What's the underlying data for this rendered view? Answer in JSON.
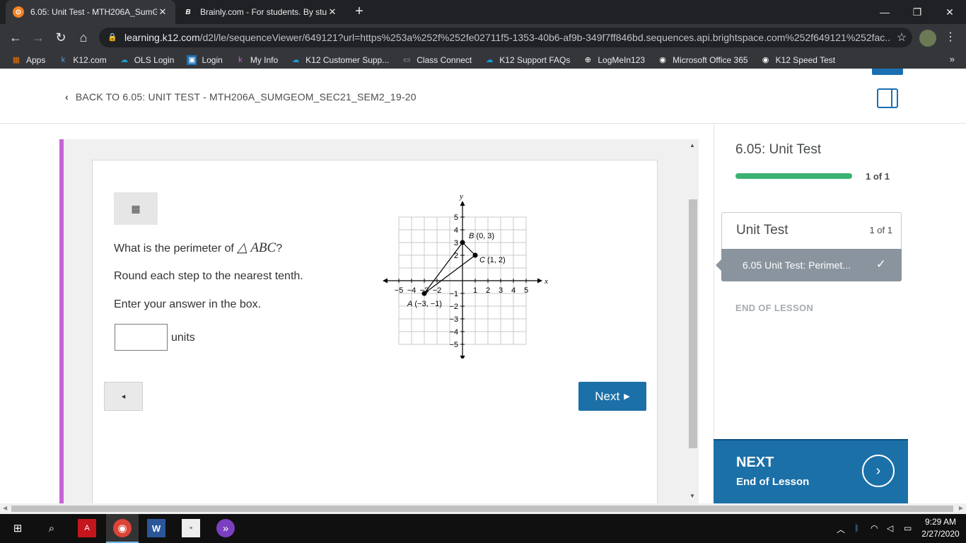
{
  "browser": {
    "tabs": [
      {
        "title": "6.05: Unit Test - MTH206A_SumG",
        "icon": "k12-icon"
      },
      {
        "title": "Brainly.com - For students. By stu",
        "icon": "brainly-icon"
      }
    ],
    "url_host": "learning.k12.com",
    "url_rest": "/d2l/le/sequenceViewer/649121?url=https%253a%252f%252fe02711f5-1353-40b6-af9b-349f7ff846bd.sequences.api.brightspace.com%252f649121%252fac...",
    "bookmarks": [
      {
        "label": "Apps",
        "icon": "apps-grid-icon"
      },
      {
        "label": "K12.com",
        "icon": "k12-icon"
      },
      {
        "label": "OLS Login",
        "icon": "cloud-icon"
      },
      {
        "label": "Login",
        "icon": "login-icon"
      },
      {
        "label": "My Info",
        "icon": "k-icon"
      },
      {
        "label": "K12 Customer Supp...",
        "icon": "cloud-icon"
      },
      {
        "label": "Class Connect",
        "icon": "page-icon"
      },
      {
        "label": "K12 Support FAQs",
        "icon": "cloud-icon"
      },
      {
        "label": "LogMeIn123",
        "icon": "plus-circle-icon"
      },
      {
        "label": "Microsoft Office 365",
        "icon": "globe-icon"
      },
      {
        "label": "K12 Speed Test",
        "icon": "globe-icon"
      }
    ]
  },
  "header": {
    "back_label": "BACK TO 6.05: UNIT TEST - MTH206A_SUMGEOM_SEC21_SEM2_19-20"
  },
  "question": {
    "prompt_pre": "What is the perimeter of ",
    "prompt_math": "△ ABC",
    "prompt_post": "?",
    "line2": "Round each step to the nearest tenth.",
    "line3": "Enter your answer in the box.",
    "answer_value": "",
    "units_label": "units",
    "prev_label": "◂",
    "next_label": "Next"
  },
  "graph": {
    "x_axis_label": "x",
    "y_axis_label": "y",
    "x_ticks": [
      "−5",
      "−4",
      "−3",
      "−2",
      "1",
      "2",
      "3",
      "4",
      "5"
    ],
    "y_ticks": [
      "5",
      "4",
      "3",
      "2",
      "−1",
      "−2",
      "−3",
      "−4",
      "−5"
    ],
    "points": [
      {
        "name": "A",
        "coord": "(−3, −1)",
        "x": -3,
        "y": -1
      },
      {
        "name": "B",
        "coord": "(0, 3)",
        "x": 0,
        "y": 3
      },
      {
        "name": "C",
        "coord": "(1, 2)",
        "x": 1,
        "y": 2
      }
    ]
  },
  "sidebar": {
    "title": "6.05: Unit Test",
    "progress_count": "1 of 1",
    "progress_fraction": 1.0,
    "unit_heading": "Unit Test",
    "unit_count": "1 of 1",
    "item_label": "6.05 Unit Test: Perimet...",
    "end_label": "END OF LESSON",
    "next_title": "NEXT",
    "next_subtitle": "End of Lesson"
  },
  "taskbar": {
    "time": "9:29 AM",
    "date": "2/27/2020"
  },
  "colors": {
    "accent_blue": "#1b70a8",
    "progress_green": "#3bb273",
    "stripe_purple": "#c765d6"
  }
}
